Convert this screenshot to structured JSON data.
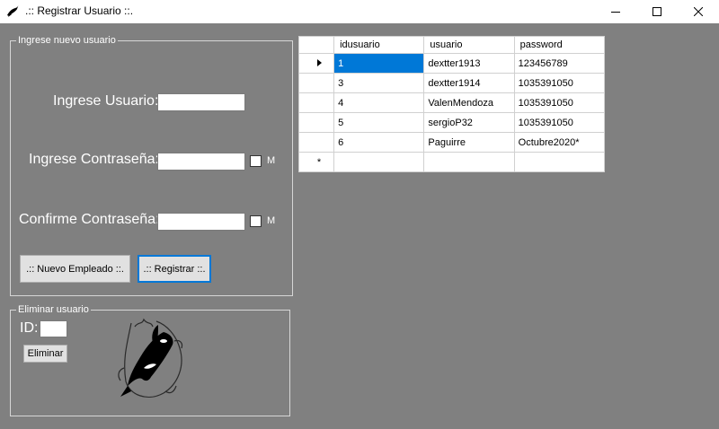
{
  "window": {
    "title": ".:: Registrar Usuario ::.",
    "app_icon": "orca-icon",
    "controls": [
      "minimize-icon",
      "maximize-icon",
      "close-icon"
    ]
  },
  "new_user_group": {
    "legend": "Ingrese nuevo usuario",
    "user_label": "Ingrese Usuario:",
    "user_value": "",
    "password_label": "Ingrese Contraseña:",
    "password_value": "",
    "password_show_label": "M",
    "confirm_label": "Confirme Contraseña:",
    "confirm_value": "",
    "confirm_show_label": "M",
    "new_employee_button": ".:: Nuevo Empleado ::.",
    "register_button": ".:: Registrar ::."
  },
  "delete_group": {
    "legend": "Eliminar usuario",
    "id_label": "ID:",
    "id_value": "",
    "delete_button": "Eliminar",
    "image": "orca-logo"
  },
  "grid": {
    "columns": [
      "idusuario",
      "usuario",
      "password"
    ],
    "rows": [
      {
        "id": "1",
        "usuario": "dextter1913",
        "password": "123456789"
      },
      {
        "id": "3",
        "usuario": "dextter1914",
        "password": "1035391050"
      },
      {
        "id": "4",
        "usuario": "ValenMendoza",
        "password": "1035391050"
      },
      {
        "id": "5",
        "usuario": "sergioP32",
        "password": "1035391050"
      },
      {
        "id": "6",
        "usuario": "Paguirre",
        "password": "Octubre2020*"
      }
    ],
    "new_row_marker": "*"
  }
}
